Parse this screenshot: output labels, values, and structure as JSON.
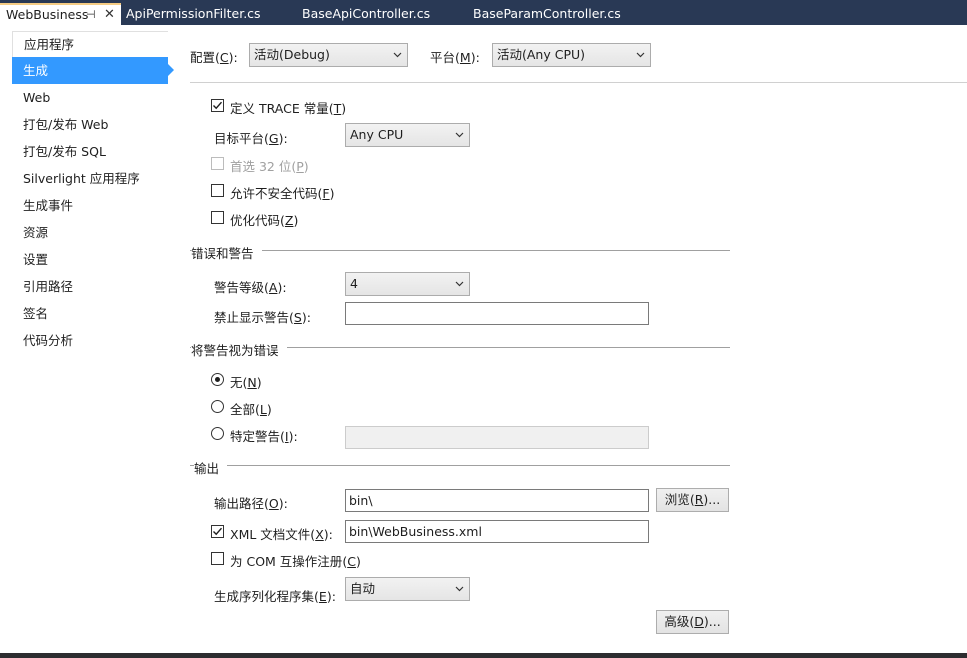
{
  "tabs": [
    {
      "label": "WebBusiness",
      "active": true
    },
    {
      "label": "ApiPermissionFilter.cs",
      "active": false
    },
    {
      "label": "BaseApiController.cs",
      "active": false
    },
    {
      "label": "BaseParamController.cs",
      "active": false
    }
  ],
  "nav": {
    "items": [
      {
        "label": "应用程序"
      },
      {
        "label": "生成"
      },
      {
        "label": "Web"
      },
      {
        "label": "打包/发布 Web"
      },
      {
        "label": "打包/发布 SQL"
      },
      {
        "label": "Silverlight 应用程序"
      },
      {
        "label": "生成事件"
      },
      {
        "label": "资源"
      },
      {
        "label": "设置"
      },
      {
        "label": "引用路径"
      },
      {
        "label": "签名"
      },
      {
        "label": "代码分析"
      }
    ],
    "selected_index": 1
  },
  "config": {
    "label": "配置",
    "mnemonic": "C",
    "value": "活动(Debug)",
    "platform_label": "平台",
    "platform_mnemonic": "M",
    "platform_value": "活动(Any CPU)"
  },
  "general": {
    "define_trace": {
      "label": "定义 TRACE 常量",
      "mnemonic": "T",
      "checked": true
    },
    "target_platform": {
      "label": "目标平台",
      "mnemonic": "G",
      "value": "Any CPU"
    },
    "prefer32": {
      "label": "首选 32 位",
      "mnemonic": "P",
      "checked": false,
      "disabled": true
    },
    "allow_unsafe": {
      "label": "允许不安全代码",
      "mnemonic": "F",
      "checked": false
    },
    "optimize": {
      "label": "优化代码",
      "mnemonic": "Z",
      "checked": false
    }
  },
  "errors": {
    "section_title": "错误和警告",
    "warning_level": {
      "label": "警告等级",
      "mnemonic": "A",
      "value": "4"
    },
    "suppress": {
      "label": "禁止显示警告",
      "mnemonic": "S",
      "value": ""
    }
  },
  "treat_warnings": {
    "section_title": "将警告视为错误",
    "none": {
      "label": "无",
      "mnemonic": "N",
      "selected": true
    },
    "all": {
      "label": "全部",
      "mnemonic": "L",
      "selected": false
    },
    "specific": {
      "label": "特定警告",
      "mnemonic": "I",
      "selected": false,
      "value": ""
    }
  },
  "output": {
    "section_title": "输出",
    "path": {
      "label": "输出路径",
      "mnemonic": "O",
      "value": "bin\\"
    },
    "browse_button": {
      "label": "浏览",
      "mnemonic": "R"
    },
    "xml_doc": {
      "label": "XML 文档文件",
      "mnemonic": "X",
      "checked": true,
      "value": "bin\\WebBusiness.xml"
    },
    "com_interop": {
      "label": "为 COM 互操作注册",
      "mnemonic": "C",
      "checked": false
    },
    "serialization": {
      "label": "生成序列化程序集",
      "mnemonic": "E",
      "value": "自动"
    },
    "advanced_button": {
      "label": "高级",
      "mnemonic": "D"
    }
  },
  "icons": {
    "pin": "pin-icon",
    "close": "close-icon",
    "chevron": "chevron-down-icon",
    "check": "check-icon"
  }
}
